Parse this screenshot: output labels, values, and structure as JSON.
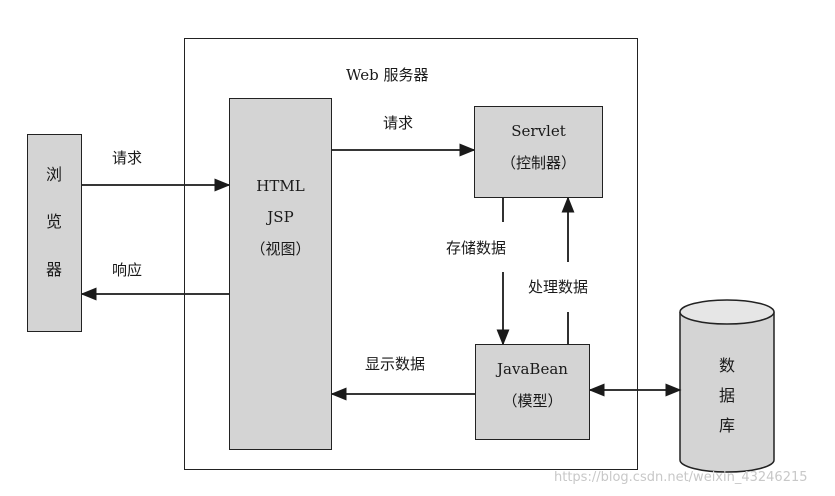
{
  "diagram": {
    "server_title": "Web 服务器",
    "browser": {
      "chars": [
        "浏",
        "览",
        "器"
      ]
    },
    "view": {
      "line1": "HTML",
      "line2": "JSP",
      "line3": "（视图）"
    },
    "servlet": {
      "line1": "Servlet",
      "line2": "（控制器）"
    },
    "javabean": {
      "line1": "JavaBean",
      "line2": "（模型）"
    },
    "database": {
      "chars": [
        "数",
        "据",
        "库"
      ]
    },
    "edges": {
      "browser_request": "请求",
      "browser_response": "响应",
      "view_request": "请求",
      "store_data": "存储数据",
      "process_data": "处理数据",
      "display_data": "显示数据"
    }
  },
  "watermark": "https://blog.csdn.net/weixin_43246215"
}
